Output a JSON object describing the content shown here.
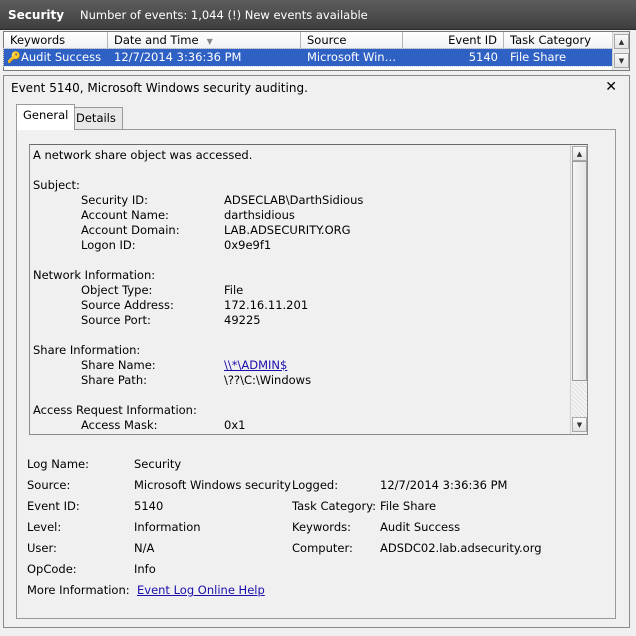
{
  "header": {
    "title": "Security",
    "events_text": "Number of events: 1,044 (!) New events available"
  },
  "list": {
    "columns": [
      "Keywords",
      "Date and Time",
      "Source",
      "Event ID",
      "Task Category"
    ],
    "row": {
      "keywords": "Audit Success",
      "date_time": "12/7/2014 3:36:36 PM",
      "source": "Microsoft Windo…",
      "event_id": "5140",
      "task_category": "File Share"
    }
  },
  "pane": {
    "title": "Event 5140, Microsoft Windows security auditing.",
    "tab_general": "General",
    "tab_details": "Details"
  },
  "message": {
    "l1": "A network share object was accessed.",
    "subject_header": "Subject:",
    "security_id_label": "Security ID:",
    "security_id": "ADSECLAB\\DarthSidious",
    "account_name_label": "Account Name:",
    "account_name": "darthsidious",
    "account_domain_label": "Account Domain:",
    "account_domain": "LAB.ADSECURITY.ORG",
    "logon_id_label": "Logon ID:",
    "logon_id": "0x9e9f1",
    "network_header": "Network Information:",
    "object_type_label": "Object Type:",
    "object_type": "File",
    "source_address_label": "Source Address:",
    "source_address": "172.16.11.201",
    "source_port_label": "Source Port:",
    "source_port": "49225",
    "share_header": "Share Information:",
    "share_name_label": "Share Name:",
    "share_name": "\\\\*\\ADMIN$",
    "share_path_label": "Share Path:",
    "share_path": "\\??\\C:\\Windows",
    "access_header": "Access Request Information:",
    "access_mask_label": "Access Mask:",
    "access_mask": "0x1"
  },
  "props": {
    "log_name_label": "Log Name:",
    "log_name": "Security",
    "source_label": "Source:",
    "source": "Microsoft Windows security",
    "logged_label": "Logged:",
    "logged": "12/7/2014 3:36:36 PM",
    "event_id_label": "Event ID:",
    "event_id": "5140",
    "task_category_label": "Task Category:",
    "task_category": "File Share",
    "level_label": "Level:",
    "level": "Information",
    "keywords_label": "Keywords:",
    "keywords": "Audit Success",
    "user_label": "User:",
    "user": "N/A",
    "computer_label": "Computer:",
    "computer": "ADSDC02.lab.adsecurity.org",
    "opcode_label": "OpCode:",
    "opcode": "Info",
    "more_info_label": "More Information:",
    "more_info_link": "Event Log Online Help"
  }
}
